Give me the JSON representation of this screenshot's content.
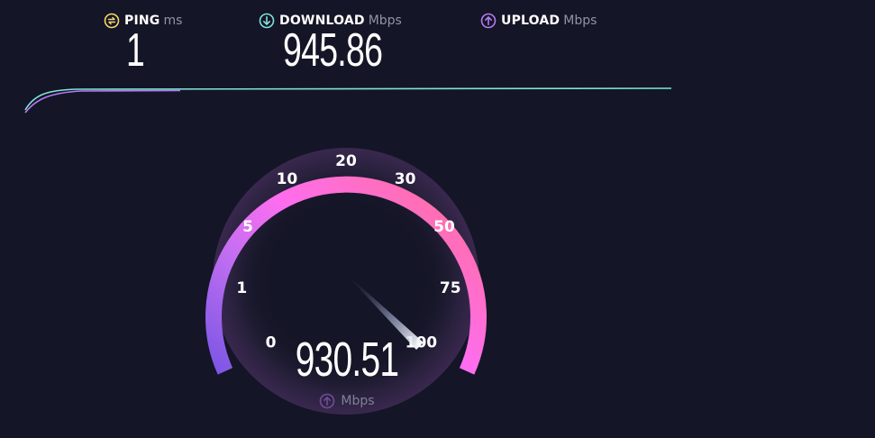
{
  "metrics": {
    "ping": {
      "label": "PING",
      "unit": "ms",
      "value": "1",
      "icon": "ping-icon",
      "color": "#f5d76e"
    },
    "download": {
      "label": "DOWNLOAD",
      "unit": "Mbps",
      "value": "945.86",
      "icon": "download-arrow-icon",
      "color": "#7fe3d9"
    },
    "upload": {
      "label": "UPLOAD",
      "unit": "Mbps",
      "value": "",
      "icon": "upload-arrow-icon",
      "color": "#b57bf0"
    }
  },
  "gauge": {
    "ticks": [
      "0",
      "1",
      "5",
      "10",
      "20",
      "30",
      "50",
      "75",
      "100"
    ],
    "value": "930.51",
    "unit": "Mbps",
    "unit_icon": "upload-arrow-icon",
    "needle_fraction": 1.0,
    "colors": {
      "start": "#7b56e4",
      "middle": "#ff6df0",
      "end": "#ff6fa6"
    }
  },
  "graph": {
    "colors": {
      "download": "#7fe3d9",
      "upload": "#b57bf0"
    }
  }
}
